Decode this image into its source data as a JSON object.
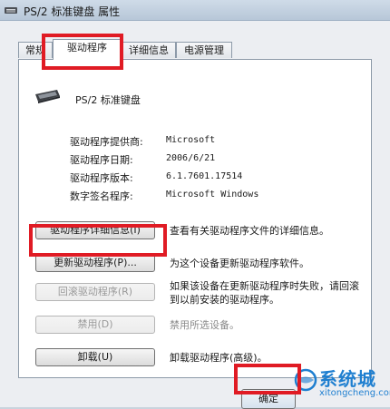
{
  "window": {
    "title": "PS/2 标准键盘 属性"
  },
  "tabs": [
    {
      "label": "常规"
    },
    {
      "label": "驱动程序"
    },
    {
      "label": "详细信息"
    },
    {
      "label": "电源管理"
    }
  ],
  "device": {
    "name": "PS/2 标准键盘",
    "icon": "keyboard-icon"
  },
  "info": [
    {
      "label": "驱动程序提供商:",
      "value": "Microsoft"
    },
    {
      "label": "驱动程序日期:",
      "value": "2006/6/21"
    },
    {
      "label": "驱动程序版本:",
      "value": "6.1.7601.17514"
    },
    {
      "label": "数字签名程序:",
      "value": "Microsoft Windows"
    }
  ],
  "actions": [
    {
      "button": "驱动程序详细信息(I)",
      "description": "查看有关驱动程序文件的详细信息。"
    },
    {
      "button": "更新驱动程序(P)...",
      "description": "为这个设备更新驱动程序软件。"
    },
    {
      "button": "回滚驱动程序(R)",
      "description": "如果该设备在更新驱动程序时失败，请回滚到以前安装的驱动程序。"
    },
    {
      "button": "禁用(D)",
      "description": "禁用所选设备。"
    },
    {
      "button": "卸载(U)",
      "description": "卸载驱动程序(高级)。"
    }
  ],
  "footer": {
    "ok_label": "确定"
  },
  "watermark": {
    "brand": "系统城",
    "url": "xitongcheng.com"
  },
  "colors": {
    "highlight": "#e01b24",
    "watermark": "#1f7fd0"
  }
}
